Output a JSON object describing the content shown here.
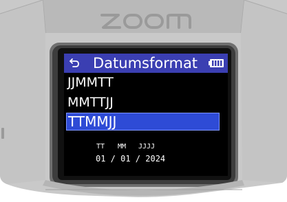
{
  "device": {
    "brand_logo": "ZOOM"
  },
  "screen": {
    "title": "Datumsformat",
    "back_icon": "return-arrow-icon",
    "battery_icon": "battery-full-icon",
    "menu_items": [
      {
        "label": "JJMMTT",
        "selected": false
      },
      {
        "label": "MMTTJJ",
        "selected": false
      },
      {
        "label": "TTMMJJ",
        "selected": true
      }
    ],
    "preview": {
      "day_label": "TT",
      "month_label": "MM",
      "year_label": "JJJJ",
      "value": "01 / 01 / 2024"
    }
  },
  "colors": {
    "title_bar": "#3b3fb2",
    "selection": "#2e4bd6",
    "screen_bg": "#000000",
    "text": "#ffffff"
  }
}
